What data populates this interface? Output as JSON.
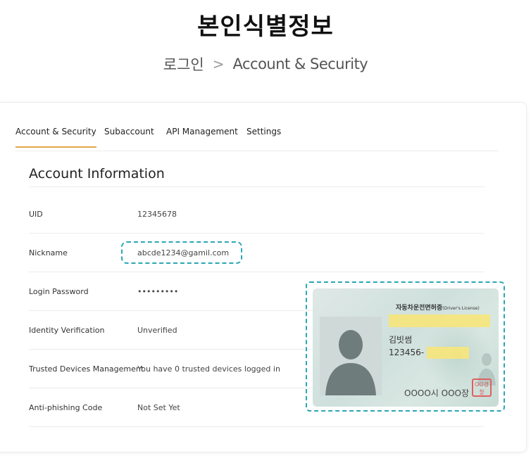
{
  "page": {
    "title": "본인식별정보",
    "breadcrumb": {
      "home": "로그인",
      "separator": ">",
      "current": "Account & Security"
    }
  },
  "tabs": [
    {
      "label": "Account & Security",
      "active": true
    },
    {
      "label": "Subaccount",
      "active": false
    },
    {
      "label": "API Management",
      "active": false
    },
    {
      "label": "Settings",
      "active": false
    }
  ],
  "section": {
    "title": "Account Information"
  },
  "rows": [
    {
      "label": "UID",
      "value": "12345678"
    },
    {
      "label": "Nickname",
      "value": "abcde1234@gamil.com"
    },
    {
      "label": "Login Password",
      "value": "•••••••••"
    },
    {
      "label": "Identity Verification",
      "value": "Unverified"
    },
    {
      "label": "Trusted Devices Management",
      "value": "You have 0 trusted devices logged in"
    },
    {
      "label": "Anti-phishing Code",
      "value": "Not Set Yet"
    }
  ],
  "id_card": {
    "title": "자동차운전면허증",
    "subtitle": "(Driver's License)",
    "name": "김빗썸",
    "number": "123456-",
    "issuer": "OOOO시 OOO장",
    "seal": "OO경찰"
  },
  "colors": {
    "tab_active": "#e0a84c",
    "highlight_outline": "#2ba6b5",
    "redaction": "#f7e67a",
    "seal": "#e06060"
  }
}
